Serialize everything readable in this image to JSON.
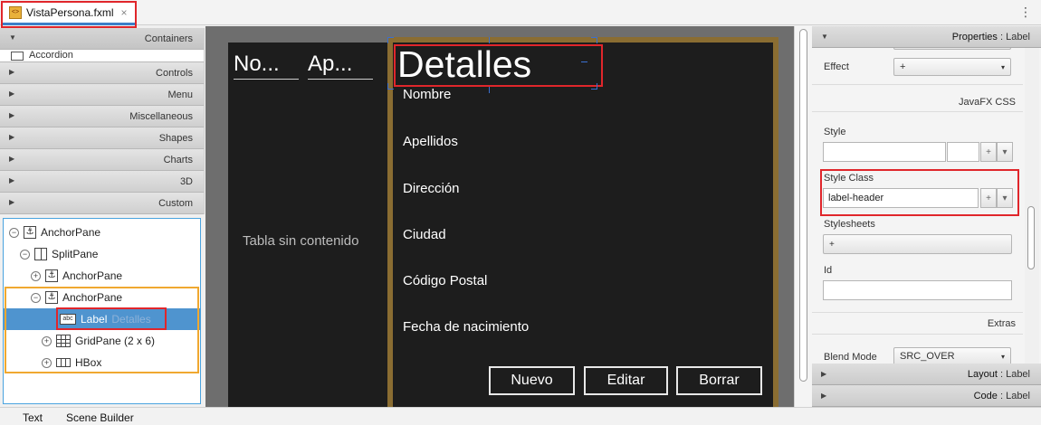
{
  "tab": {
    "title": "VistaPersona.fxml",
    "close": "×",
    "icon": "fxml-file-icon"
  },
  "window": {
    "menu_icon": "⋮"
  },
  "library": {
    "sections": [
      {
        "label": "Containers",
        "open": true
      },
      {
        "label": "Controls"
      },
      {
        "label": "Menu"
      },
      {
        "label": "Miscellaneous"
      },
      {
        "label": "Shapes"
      },
      {
        "label": "Charts"
      },
      {
        "label": "3D"
      },
      {
        "label": "Custom"
      }
    ],
    "containers_first_item": "Accordion"
  },
  "hierarchy": {
    "nodes": [
      {
        "label": "AnchorPane",
        "toggle": "−",
        "icon": "⚓"
      },
      {
        "label": "SplitPane",
        "toggle": "−",
        "icon": "split"
      },
      {
        "label": "AnchorPane",
        "toggle": "+",
        "icon": "⚓"
      },
      {
        "label": "AnchorPane",
        "toggle": "−",
        "icon": "⚓"
      },
      {
        "label": "Label",
        "sublabel": "Detalles",
        "icon": "abc"
      },
      {
        "label": "GridPane (2 x 6)",
        "toggle": "+",
        "icon": "grid"
      },
      {
        "label": "HBox",
        "toggle": "+",
        "icon": "hbox"
      }
    ]
  },
  "bottom_tabs": [
    "Text",
    "Scene Builder"
  ],
  "canvas": {
    "columns": [
      "No...",
      "Ap..."
    ],
    "empty_table": "Tabla sin contenido",
    "header": "Detalles",
    "fields": [
      "Nombre",
      "Apellidos",
      "Dirección",
      "Ciudad",
      "Código Postal",
      "Fecha de nacimiento"
    ],
    "buttons": [
      "Nuevo",
      "Editar",
      "Borrar"
    ]
  },
  "inspector": {
    "properties_title": "Properties",
    "properties_sub": ": Label",
    "effect_label": "Effect",
    "effect_value": "+",
    "css_section": "JavaFX CSS",
    "style_label": "Style",
    "style_class_label": "Style Class",
    "style_class_value": "label-header",
    "stylesheets_label": "Stylesheets",
    "stylesheets_button": "+",
    "id_label": "Id",
    "extras_section": "Extras",
    "blend_mode_label": "Blend Mode",
    "blend_mode_value": "SRC_OVER",
    "layout_title": "Layout",
    "layout_sub": ": Label",
    "code_title": "Code",
    "code_sub": ": Label",
    "plus": "+",
    "dd": "▾"
  }
}
